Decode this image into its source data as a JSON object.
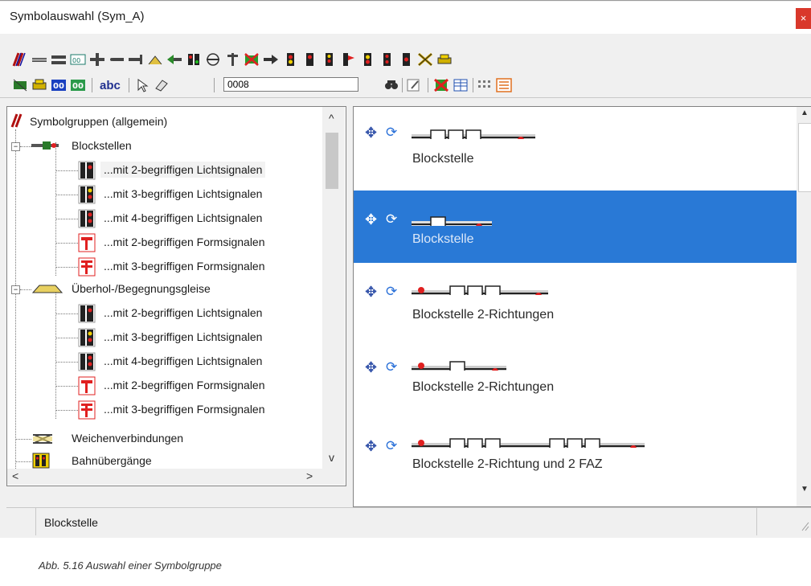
{
  "window": {
    "title": "Symbolauswahl (Sym_A)",
    "close_label": "×"
  },
  "toolbar2": {
    "number_value": "0008",
    "abc_label": "abc"
  },
  "tree": {
    "root_label": "Symbolgruppen (allgemein)",
    "groups": [
      {
        "label": "Blockstellen",
        "children": [
          "...mit 2-begriffigen Lichtsignalen",
          "...mit 3-begriffigen Lichtsignalen",
          "...mit 4-begriffigen Lichtsignalen",
          "...mit 2-begriffigen Formsignalen",
          "...mit 3-begriffigen Formsignalen"
        ]
      },
      {
        "label": "Überhol-/Begegnungsgleise",
        "children": [
          "...mit 2-begriffigen Lichtsignalen",
          "...mit 3-begriffigen Lichtsignalen",
          "...mit 4-begriffigen Lichtsignalen",
          "...mit 2-begriffigen Formsignalen",
          "...mit 3-begriffigen Formsignalen"
        ]
      }
    ],
    "others": [
      "Weichenverbindungen",
      "Bahnübergänge"
    ]
  },
  "symbols": [
    "Blockstelle",
    "Blockstelle",
    "Blockstelle 2-Richtungen",
    "Blockstelle 2-Richtungen",
    "Blockstelle 2-Richtung und 2 FAZ"
  ],
  "status": {
    "text": "Blockstelle"
  },
  "caption": "Abb. 5.16    Auswahl einer Symbolgruppe",
  "colors": {
    "selection": "#2979d6",
    "signal_red": "#e02020",
    "signal_yellow": "#f0d000"
  }
}
